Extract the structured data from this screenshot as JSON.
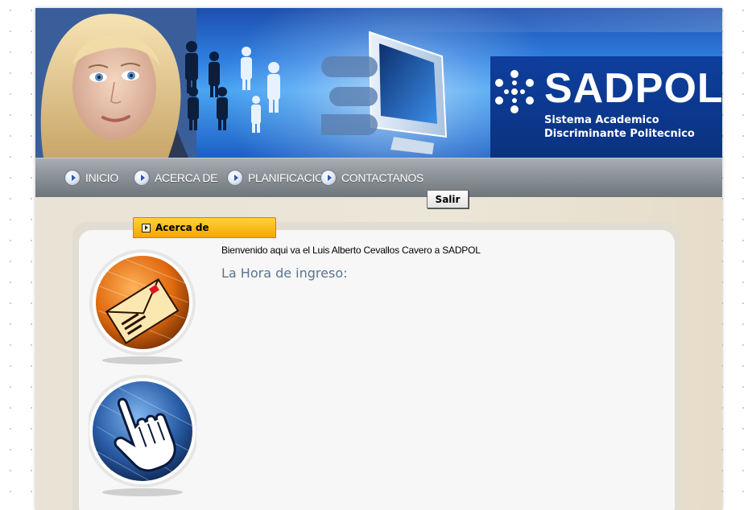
{
  "header": {
    "logo_title": "SADPOL",
    "logo_subtitle": "Sistema Academico\nDiscriminante Politecnico"
  },
  "nav": {
    "items": [
      {
        "label": "INICIO"
      },
      {
        "label": "ACERCA DE"
      },
      {
        "label": "PLANIFICACION"
      },
      {
        "label": "CONTACTANOS"
      }
    ]
  },
  "logout": {
    "label": "Salir"
  },
  "tab": {
    "label": "Acerca de"
  },
  "main": {
    "welcome_text": "Bienvenido aqui va el Luis Alberto Cevallos Cavero a SADPOL",
    "login_time_label": "La Hora de ingreso",
    "login_time_colon": ":"
  },
  "colors": {
    "banner_blue": "#2f7fe0",
    "nav_gray": "#8e969b",
    "tab_orange": "#f5a800",
    "page_beige": "#ece6d8"
  },
  "icons": {
    "logo": "snowflake-dots-icon",
    "nav_bullet": "arrow-right-bullet-icon",
    "orb_1": "envelope-orb-icon",
    "orb_2": "hand-cursor-orb-icon"
  }
}
